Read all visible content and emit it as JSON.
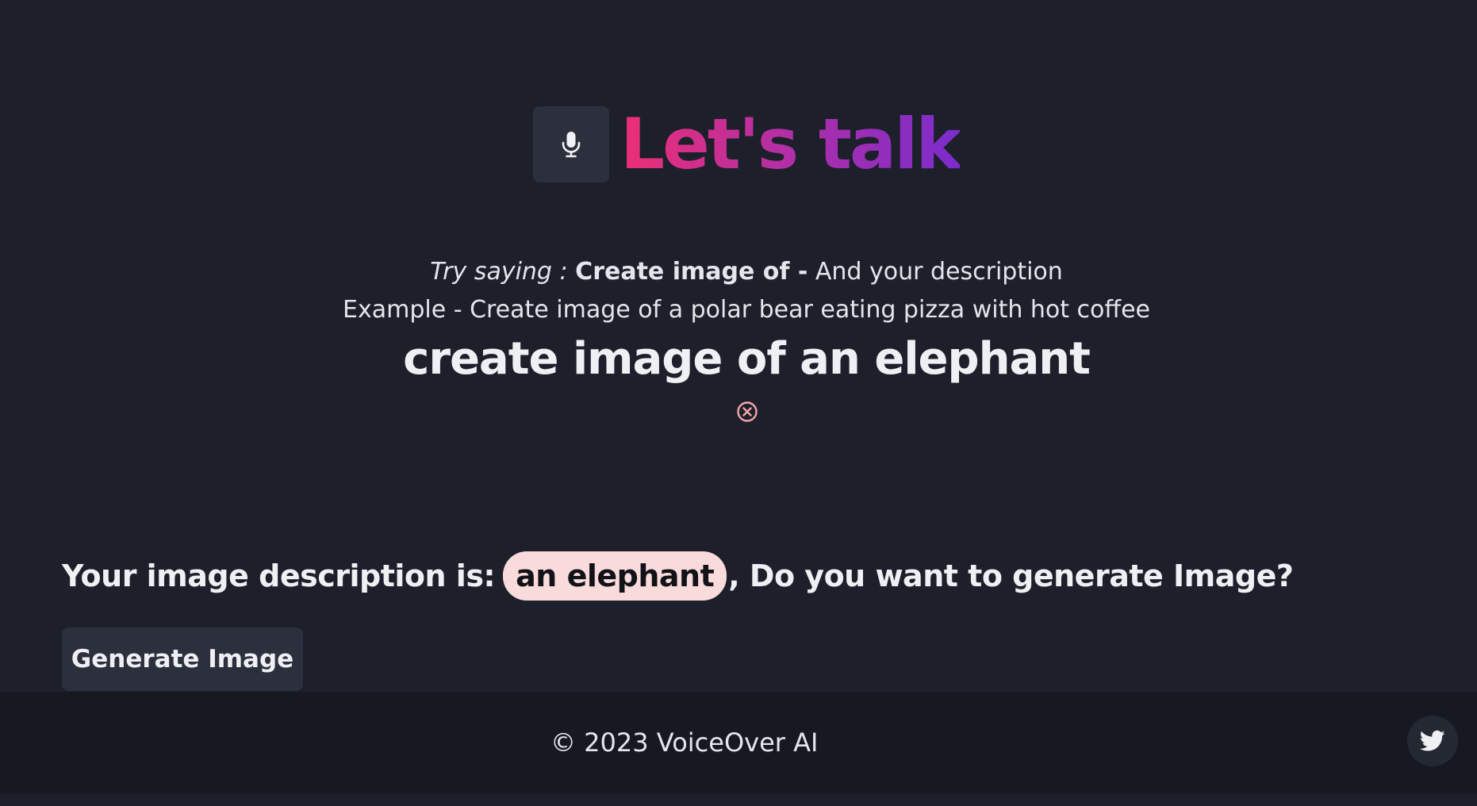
{
  "hero": {
    "mic_icon": "microphone-icon",
    "title": "Let's talk",
    "title_gradient": [
      "#ec2f75",
      "#b12fa7",
      "#7b2ccc"
    ]
  },
  "instructions": {
    "try_label": "Try saying :",
    "command": "Create image of -",
    "suffix": "And your description",
    "example": "Example - Create image of a polar bear eating pizza with hot coffee"
  },
  "transcript": {
    "text": "create image of an elephant",
    "clear_icon": "circle-x-icon"
  },
  "description": {
    "prefix": "Your image description is:",
    "value": "an elephant",
    "suffix": ", Do you want to generate Image?"
  },
  "actions": {
    "generate_label": "Generate Image"
  },
  "footer": {
    "copyright": "© 2023 VoiceOver AI",
    "social_icon": "twitter-icon"
  },
  "colors": {
    "background": "#1d202b",
    "footer_background": "#161921",
    "button_background": "#2c303d",
    "pill_background": "#fadbdc",
    "clear_icon": "#f2a5a8"
  }
}
